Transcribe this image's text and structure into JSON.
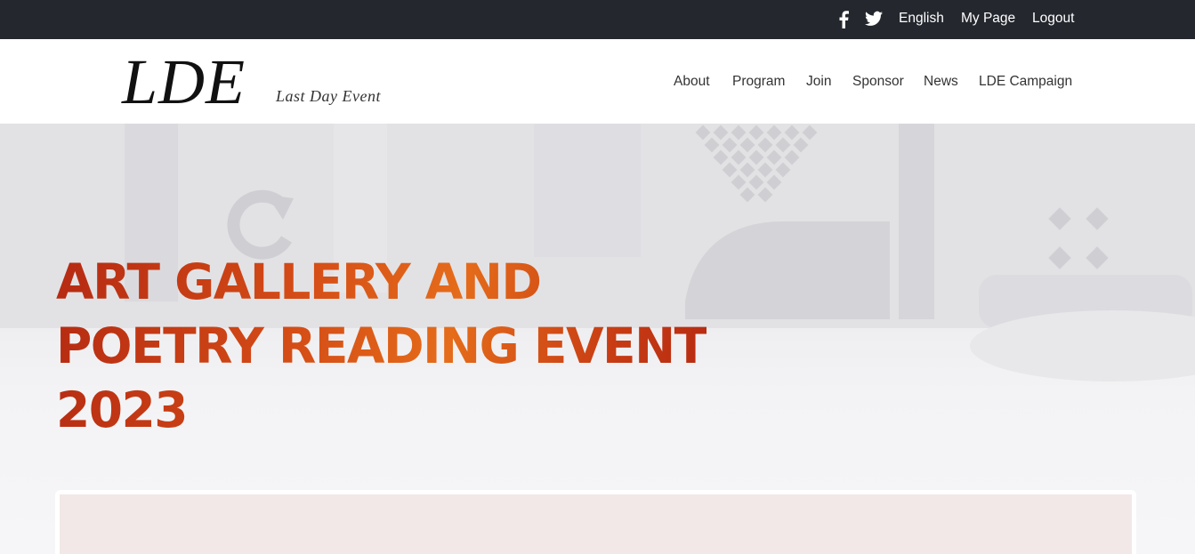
{
  "topbar": {
    "social": [
      "facebook-icon",
      "twitter-icon"
    ],
    "language": "English",
    "my_page": "My Page",
    "logout": "Logout"
  },
  "header": {
    "logo_text": "LDE",
    "logo_subtitle": "Last Day Event",
    "nav": [
      "About",
      "Program",
      "Join",
      "Sponsor",
      "News",
      "LDE Campaign"
    ]
  },
  "hero": {
    "title_lines": [
      "ART GALLERY AND",
      "POETRY READING EVENT",
      "2023"
    ]
  },
  "colors": {
    "topbar_bg": "#24272e",
    "title_orange": "#e06a1a",
    "title_red": "#b52a12",
    "card_bg": "#f2e8e8"
  }
}
